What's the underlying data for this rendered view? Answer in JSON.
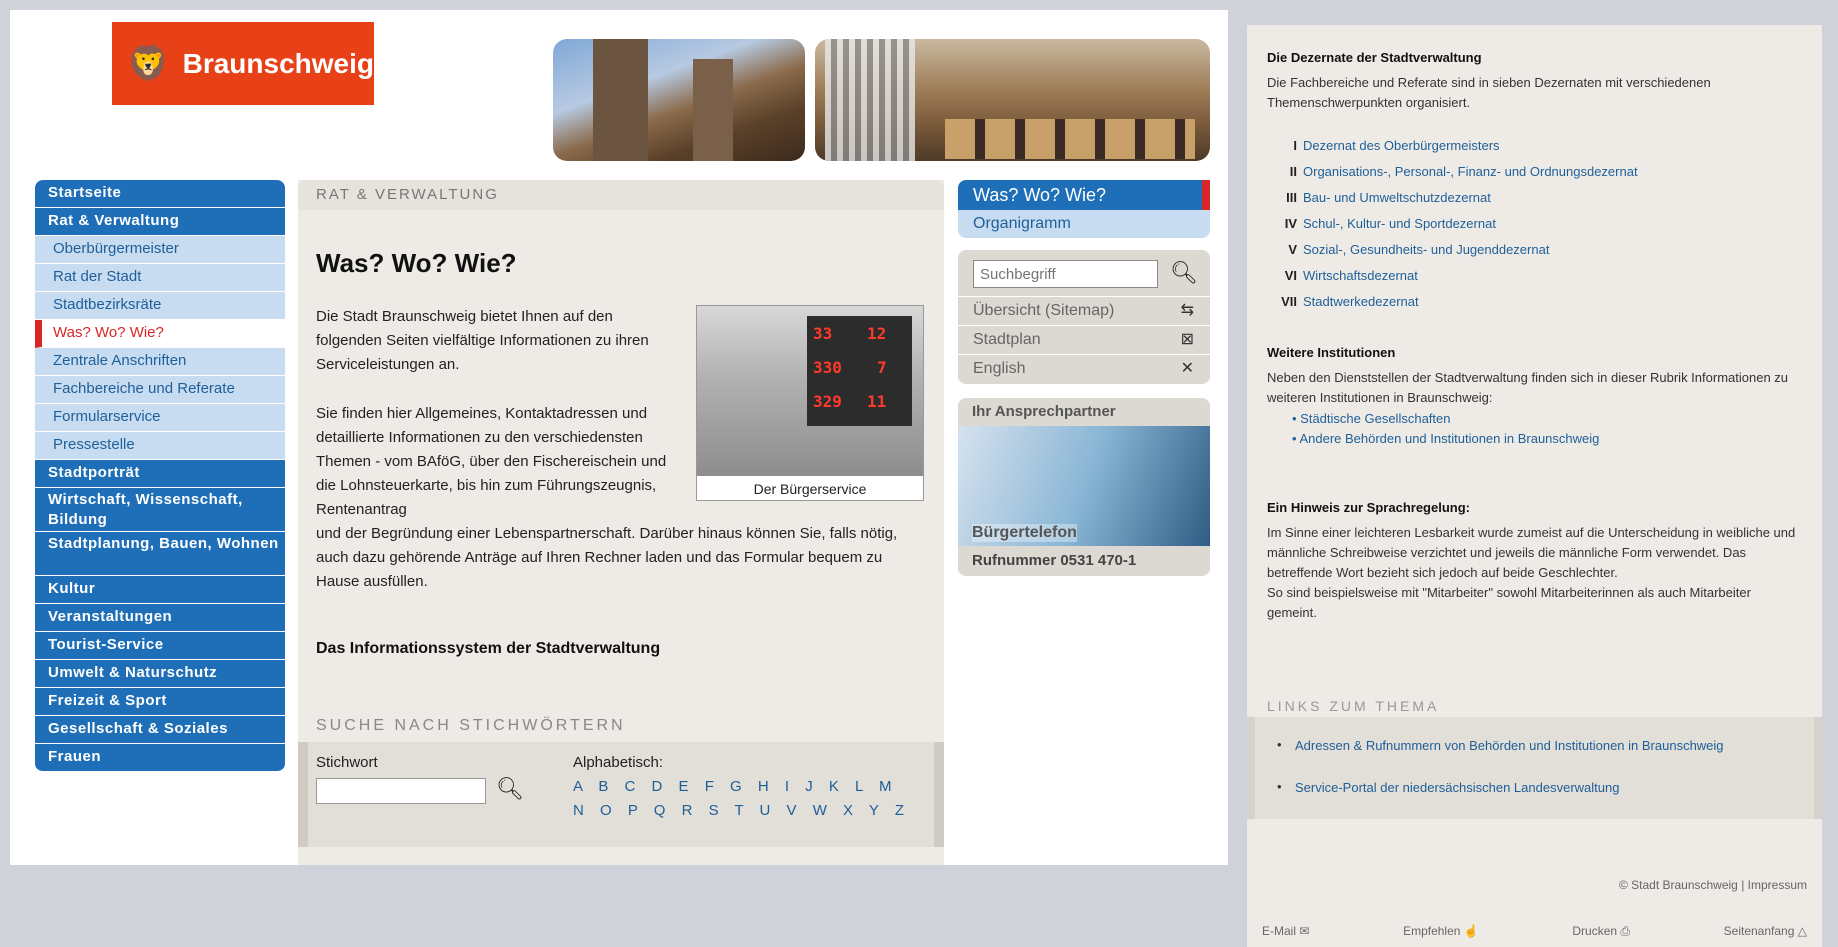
{
  "logo": {
    "text": "Braunschweig",
    "lion": "🦁"
  },
  "nav": [
    {
      "label": "Startseite",
      "type": "main"
    },
    {
      "label": "Rat & Verwaltung",
      "type": "main"
    },
    {
      "label": "Oberbürgermeister",
      "type": "sub"
    },
    {
      "label": "Rat der Stadt",
      "type": "sub"
    },
    {
      "label": "Stadtbezirksräte",
      "type": "sub"
    },
    {
      "label": "Was? Wo? Wie?",
      "type": "sub-active"
    },
    {
      "label": "Zentrale Anschriften",
      "type": "sub"
    },
    {
      "label": "Fachbereiche und Referate",
      "type": "sub"
    },
    {
      "label": "Formularservice",
      "type": "sub"
    },
    {
      "label": "Pressestelle",
      "type": "sub"
    },
    {
      "label": "Stadtporträt",
      "type": "main"
    },
    {
      "label": "Wirtschaft, Wissenschaft, Bildung",
      "type": "main2"
    },
    {
      "label": "Stadtplanung, Bauen, Wohnen",
      "type": "main2"
    },
    {
      "label": "Kultur",
      "type": "main"
    },
    {
      "label": "Veranstaltungen",
      "type": "main"
    },
    {
      "label": "Tourist-Service",
      "type": "main"
    },
    {
      "label": "Umwelt & Naturschutz",
      "type": "main"
    },
    {
      "label": "Freizeit & Sport",
      "type": "main"
    },
    {
      "label": "Gesellschaft & Soziales",
      "type": "main"
    },
    {
      "label": "Frauen",
      "type": "main"
    }
  ],
  "main": {
    "section": "RAT & VERWALTUNG",
    "title": "Was? Wo? Wie?",
    "p1": "Die Stadt Braunschweig bietet Ihnen auf den folgenden Seiten vielfältige Informationen zu ihren Serviceleistungen an.",
    "p2a": "Sie finden hier Allgemeines, Kontaktadressen und detaillierte Informationen zu den verschiedensten Themen - vom BAföG, über den Fischereischein und die Lohnsteuerkarte, bis hin zum Führungszeugnis, Rentenantrag",
    "p2b": "und der Begründung einer Lebenspartnerschaft. Darüber hinaus können Sie, falls nötig, auch dazu gehörende Anträge auf Ihren Rechner laden und das Formular bequem zu Hause ausfüllen.",
    "figure_caption": "Der Bürgerservice",
    "board": [
      "33",
      "12",
      "330",
      "7",
      "329",
      "11"
    ],
    "info_title": "Das Informationssystem der Stadtverwaltung",
    "search_head": "SUCHE NACH STICHWÖRTERN",
    "stichwort_label": "Stichwort",
    "alpha_label": "Alphabetisch:",
    "alpha_row1": "A B C D E F G H I J K L M",
    "alpha_row2": "N O P Q R S T U V W X Y Z"
  },
  "right": {
    "was": "Was? Wo? Wie?",
    "orga": "Organigramm",
    "search_placeholder": "Suchbegriff",
    "sitemap": "Übersicht (Sitemap)",
    "stadtplan": "Stadtplan",
    "english": "English",
    "contact_head": "Ihr Ansprechpartner",
    "contact_img_label": "Bürgertelefon",
    "contact_tel": "Rufnummer 0531 470-1"
  },
  "page2": {
    "dez_title": "Die Dezernate der Stadtverwaltung",
    "dez_text": "Die Fachbereiche und Referate sind in sieben Dezernaten mit verschiedenen Themenschwerpunkten organisiert.",
    "dezernate": [
      {
        "num": "I",
        "label": "Dezernat des Oberbürgermeisters"
      },
      {
        "num": "II",
        "label": "Organisations-, Personal-, Finanz- und Ordnungsdezernat"
      },
      {
        "num": "III",
        "label": "Bau- und Umweltschutzdezernat"
      },
      {
        "num": "IV",
        "label": "Schul-, Kultur- und Sportdezernat"
      },
      {
        "num": "V",
        "label": "Sozial-, Gesundheits- und Jugenddezernat"
      },
      {
        "num": "VI",
        "label": "Wirtschaftsdezernat"
      },
      {
        "num": "VII",
        "label": "Stadtwerkedezernat"
      }
    ],
    "inst_title": "Weitere Institutionen",
    "inst_text": "Neben den Dienststellen der Stadtverwaltung finden sich in dieser Rubrik Informationen zu weiteren Institutionen in Braunschweig:",
    "inst_bullets": [
      "Städtische Gesellschaften",
      "Andere Behörden und Institutionen in Braunschweig"
    ],
    "hinweis_title": "Ein Hinweis zur Sprachregelung:",
    "hinweis_text": "Im Sinne einer leichteren Lesbarkeit wurde zumeist auf die Unterscheidung in weibliche und männliche Schreibweise verzichtet und jeweils die männliche Form verwendet. Das betreffende Wort bezieht sich jedoch auf beide Geschlechter.",
    "hinweis_text2": "So sind beispielsweise mit \"Mitarbeiter\" sowohl Mitarbeiterinnen als auch Mitarbeiter gemeint.",
    "links_head": "LINKS ZUM THEMA",
    "link1": "Adressen & Rufnummern von Behörden und Institutionen in Braunschweig",
    "link2": "Service-Portal der niedersächsischen Landesverwaltung",
    "copyright": "© Stadt Braunschweig | Impressum",
    "footer_mail": "E-Mail",
    "footer_empf": "Empfehlen",
    "footer_druck": "Drucken",
    "footer_top": "Seitenanfang"
  }
}
